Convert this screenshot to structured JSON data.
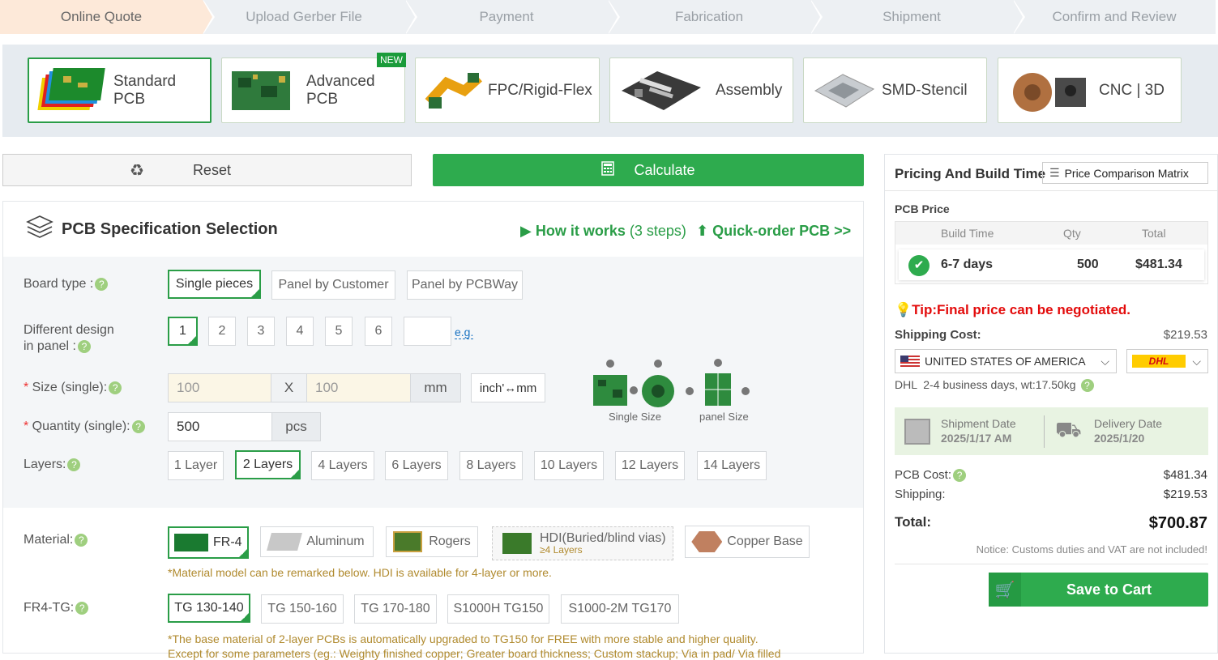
{
  "steps": [
    "Online Quote",
    "Upload Gerber File",
    "Payment",
    "Fabrication",
    "Shipment",
    "Confirm and Review"
  ],
  "products": [
    {
      "label": "Standard PCB",
      "icon": "standard-pcb-image"
    },
    {
      "label": "Advanced PCB",
      "icon": "advanced-pcb-image",
      "badge": "NEW"
    },
    {
      "label": "FPC/Rigid-Flex",
      "icon": "fpc-image"
    },
    {
      "label": "Assembly",
      "icon": "assembly-image"
    },
    {
      "label": "SMD-Stencil",
      "icon": "stencil-image"
    },
    {
      "label": "CNC | 3D",
      "icon": "cnc-image"
    }
  ],
  "actions": {
    "reset": "Reset",
    "calculate": "Calculate"
  },
  "spec": {
    "title": "PCB Specification Selection",
    "how_it_works": "How it works",
    "how_it_works_steps": "(3 steps)",
    "quick_order": "Quick-order PCB >>",
    "board_type": {
      "label": "Board type :",
      "options": [
        "Single pieces",
        "Panel by Customer",
        "Panel by PCBWay"
      ],
      "selected": "Single pieces"
    },
    "designs": {
      "label_1": "Different design",
      "label_2": "in panel :",
      "options": [
        "1",
        "2",
        "3",
        "4",
        "5",
        "6"
      ],
      "selected": "1",
      "eg": "e.g."
    },
    "size": {
      "label": "Size (single):",
      "width": "100",
      "x": "X",
      "height": "100",
      "unit": "mm",
      "toggle": "inch'↔mm"
    },
    "quantity": {
      "label": "Quantity (single):",
      "value": "500",
      "unit": "pcs"
    },
    "diagram": {
      "single": "Single Size",
      "panel": "panel Size"
    },
    "layers": {
      "label": "Layers:",
      "options": [
        "1 Layer",
        "2 Layers",
        "4 Layers",
        "6 Layers",
        "8 Layers",
        "10 Layers",
        "12 Layers",
        "14 Layers"
      ],
      "selected": "2 Layers"
    },
    "material": {
      "label": "Material:",
      "options": [
        "FR-4",
        "Aluminum",
        "Rogers",
        "HDI(Buried/blind vias)",
        "Copper Base"
      ],
      "hdi_sub": "≥4 Layers",
      "selected": "FR-4",
      "note": "*Material model can be remarked below. HDI is available for 4-layer or more."
    },
    "tg": {
      "label": "FR4-TG:",
      "options": [
        "TG 130-140",
        "TG 150-160",
        "TG 170-180",
        "S1000H TG150",
        "S1000-2M TG170"
      ],
      "selected": "TG 130-140",
      "note1": "*The base material of 2-layer PCBs is automatically upgraded to TG150 for FREE with more stable and higher quality.",
      "note2": "Except for some parameters (eg.: Weighty finished copper; Greater board thickness; Custom stackup; Via in pad/ Via filled"
    }
  },
  "pricing": {
    "title": "Pricing And Build Time",
    "matrix": "Price Comparison Matrix",
    "pcb_price": "PCB Price",
    "cols": [
      "Build Time",
      "Qty",
      "Total"
    ],
    "row": {
      "build_time": "6-7 days",
      "qty": "500",
      "total": "$481.34"
    },
    "tip": "Tip:Final price can be negotiated.",
    "shipping_cost_label": "Shipping Cost:",
    "shipping_cost": "$219.53",
    "country": "UNITED STATES OF AMERICA",
    "carrier": "DHL",
    "shipping_info": "DHL  2-4 business days, wt:17.50kg",
    "shipment_date_label": "Shipment Date",
    "shipment_date": "2025/1/17 AM",
    "delivery_date_label": "Delivery Date",
    "delivery_date": "2025/1/20",
    "pcb_cost_label": "PCB Cost:",
    "pcb_cost": "$481.34",
    "shipping_label": "Shipping:",
    "shipping": "$219.53",
    "total_label": "Total:",
    "total": "$700.87",
    "notice": "Notice: Customs duties and VAT are not included!",
    "save": "Save to Cart"
  },
  "colors": {
    "accent": "#2eab4e",
    "tip": "#e30b0b",
    "active_step": "#fde9d9"
  }
}
